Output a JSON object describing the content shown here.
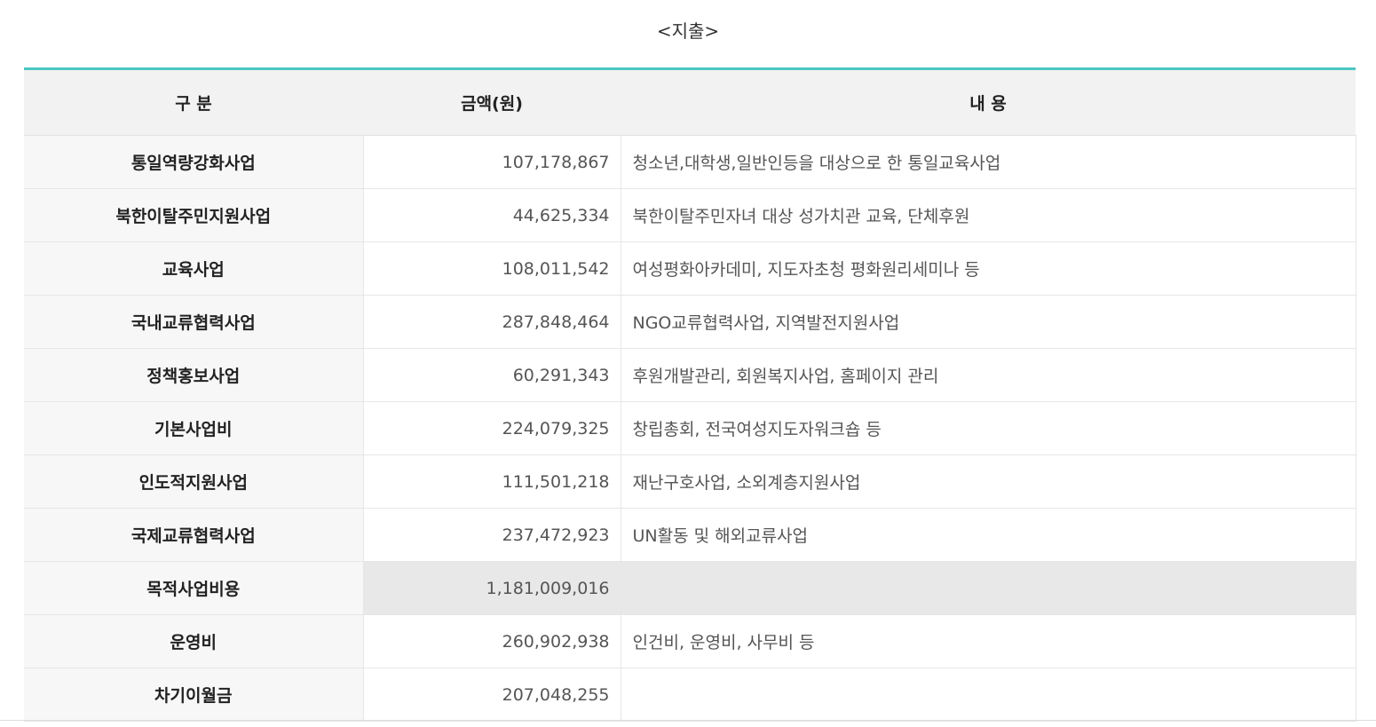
{
  "caption": "<지출>",
  "colors": {
    "accent": "#4cc6c2",
    "header_bg": "#f2f2f2",
    "category_bg": "#f7f7f7",
    "subtotal_bg": "#e8e8e8"
  },
  "table": {
    "headers": [
      "구 분",
      "금액(원)",
      "내 용"
    ],
    "rows": [
      {
        "category": "통일역량강화사업",
        "amount": "107,178,867",
        "description": "청소년,대학생,일반인등을 대상으로 한 통일교육사업"
      },
      {
        "category": "북한이탈주민지원사업",
        "amount": "44,625,334",
        "description": "북한이탈주민자녀 대상 성가치관 교육, 단체후원"
      },
      {
        "category": "교육사업",
        "amount": "108,011,542",
        "description": "여성평화아카데미, 지도자초청 평화원리세미나 등"
      },
      {
        "category": "국내교류협력사업",
        "amount": "287,848,464",
        "description": "NGO교류협력사업, 지역발전지원사업"
      },
      {
        "category": "정책홍보사업",
        "amount": "60,291,343",
        "description": "후원개발관리, 회원복지사업, 홈페이지 관리"
      },
      {
        "category": "기본사업비",
        "amount": "224,079,325",
        "description": "창립총회, 전국여성지도자워크숍 등"
      },
      {
        "category": "인도적지원사업",
        "amount": "111,501,218",
        "description": "재난구호사업, 소외계층지원사업"
      },
      {
        "category": "국제교류협력사업",
        "amount": "237,472,923",
        "description": "UN활동 및 해외교류사업"
      },
      {
        "category": "목적사업비용",
        "amount": "1,181,009,016",
        "description": ""
      },
      {
        "category": "운영비",
        "amount": "260,902,938",
        "description": "인건비, 운영비, 사무비 등"
      },
      {
        "category": "차기이월금",
        "amount": "207,048,255",
        "description": ""
      }
    ]
  }
}
